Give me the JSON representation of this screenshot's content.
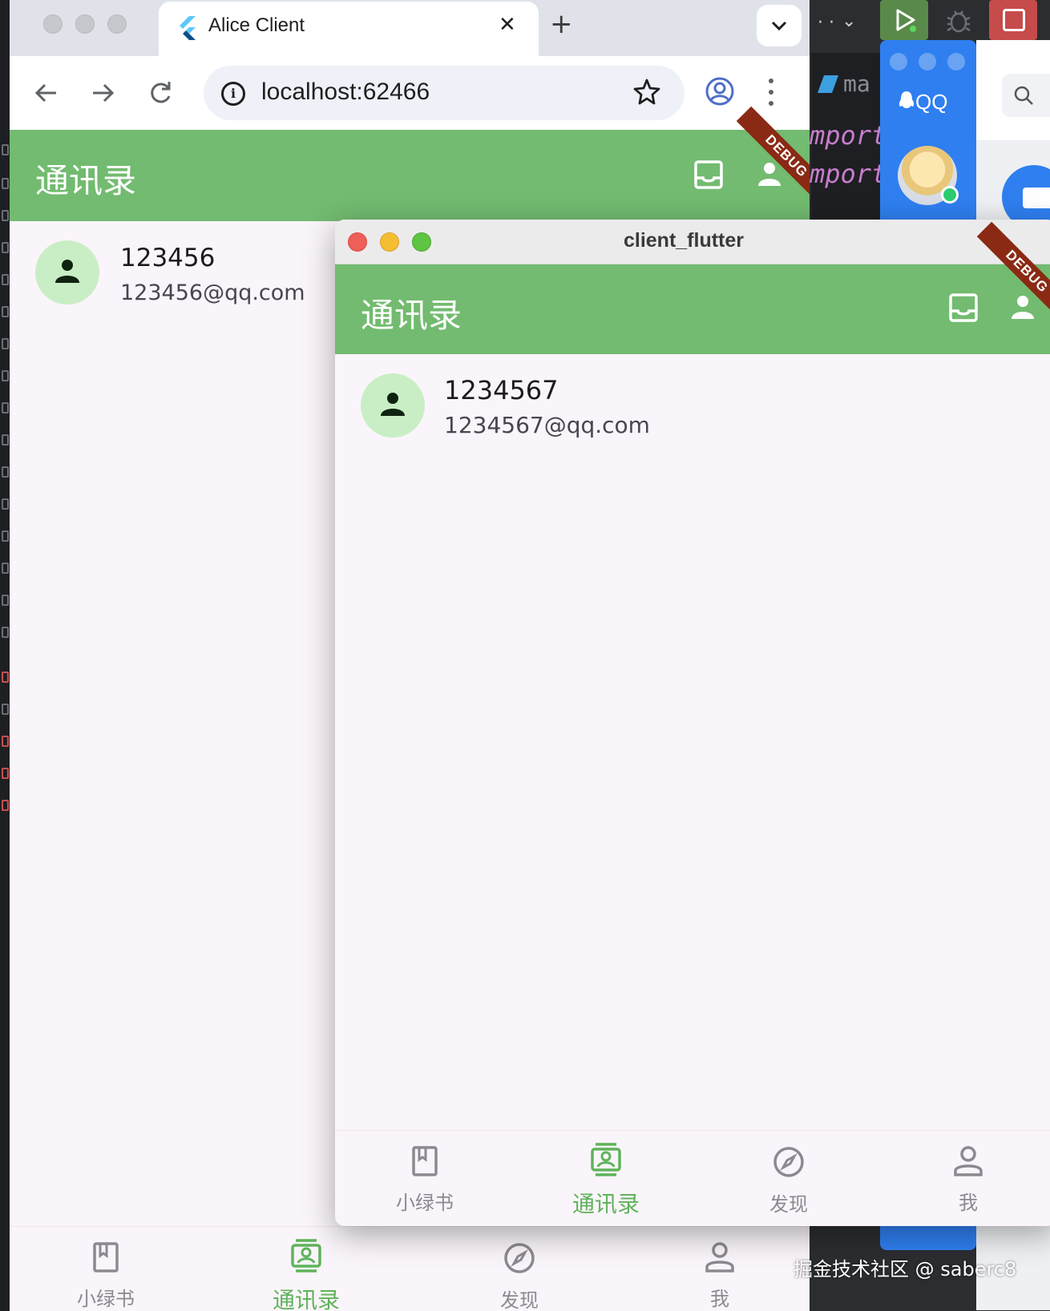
{
  "browser": {
    "tab_title": "Alice Client",
    "url": "localhost:62466"
  },
  "web_app": {
    "appbar_title": "通讯录",
    "debug_label": "DEBUG",
    "contact": {
      "name": "123456",
      "email": "123456@qq.com"
    },
    "nav": [
      {
        "label": "小绿书",
        "icon": "book-icon",
        "active": false
      },
      {
        "label": "通讯录",
        "icon": "contacts-icon",
        "active": true
      },
      {
        "label": "发现",
        "icon": "compass-icon",
        "active": false
      },
      {
        "label": "我",
        "icon": "person-icon",
        "active": false
      }
    ]
  },
  "desktop_app": {
    "window_title": "client_flutter",
    "appbar_title": "通讯录",
    "debug_label": "DEBUG",
    "contact": {
      "name": "1234567",
      "email": "1234567@qq.com"
    },
    "nav": [
      {
        "label": "小绿书",
        "icon": "book-icon",
        "active": false
      },
      {
        "label": "通讯录",
        "icon": "contacts-icon",
        "active": true
      },
      {
        "label": "发现",
        "icon": "compass-icon",
        "active": false
      },
      {
        "label": "我",
        "icon": "person-icon",
        "active": false
      }
    ]
  },
  "background": {
    "ide_tab": "ma",
    "ide_code_lines": [
      "mport",
      "mport"
    ],
    "qq_logo": "QQ",
    "watermark": "掘金技术社区 @ saberc8"
  },
  "colors": {
    "appbar_green": "#72bb70",
    "active_nav_green": "#5fb35b",
    "avatar_bg": "#c9eec5",
    "debug_banner": "#8a2a14",
    "qq_blue": "#2f7ff0"
  }
}
